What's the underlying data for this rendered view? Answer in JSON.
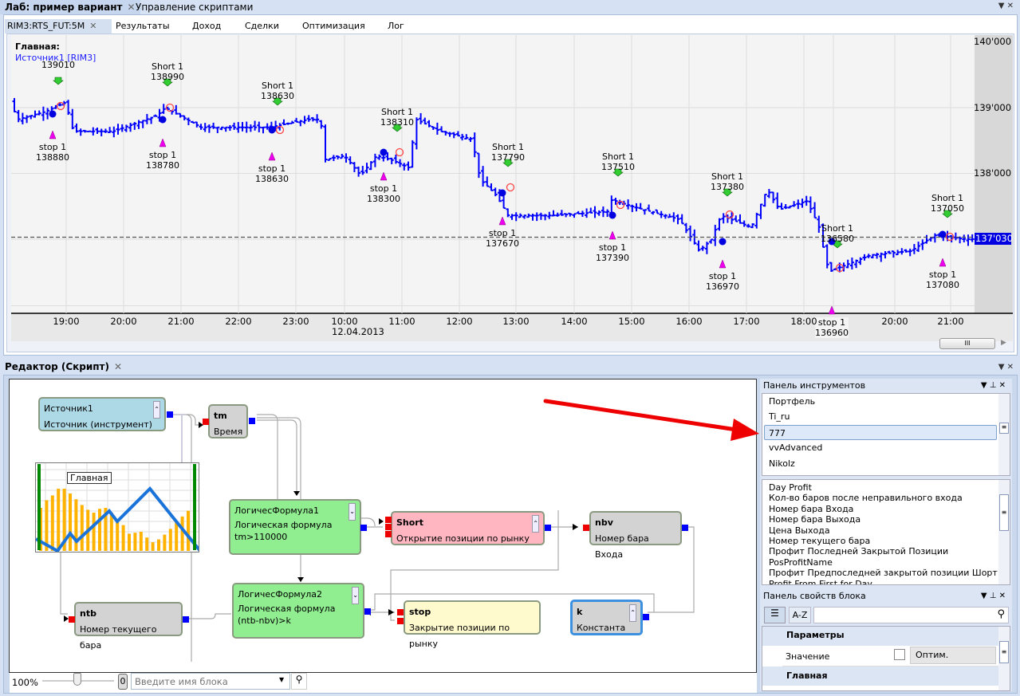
{
  "tabs": [
    {
      "label": "Лаб: пример вариант"
    },
    {
      "label": "Управление скриптами"
    }
  ],
  "subtabs": [
    "RIM3:RTS_FUT:5M",
    "Результаты",
    "Доход",
    "Сделки",
    "Оптимизация",
    "Лог"
  ],
  "chart": {
    "title": "Главная:",
    "source": "Источник1 [RIM3]",
    "price_ticks": [
      "140'000",
      "139'000",
      "138'000"
    ],
    "last_price": "137'030",
    "time_ticks": [
      "19:00",
      "20:00",
      "21:00",
      "22:00",
      "23:00",
      "10:00",
      "11:00",
      "12:00",
      "13:00",
      "14:00",
      "15:00",
      "16:00",
      "17:00",
      "18:00",
      "19:00",
      "20:00",
      "21:00"
    ],
    "date_label": "12.04.2013",
    "price_series": [
      [
        0,
        139180
      ],
      [
        12,
        138820
      ],
      [
        47,
        138940
      ],
      [
        72,
        139080
      ],
      [
        82,
        138640
      ],
      [
        132,
        138640
      ],
      [
        187,
        138880
      ],
      [
        197,
        139000
      ],
      [
        242,
        138700
      ],
      [
        282,
        138700
      ],
      [
        327,
        138700
      ],
      [
        377,
        138820
      ],
      [
        392,
        138820
      ],
      [
        397,
        138210
      ],
      [
        422,
        138270
      ],
      [
        442,
        137970
      ],
      [
        462,
        138270
      ],
      [
        482,
        138200
      ],
      [
        502,
        138090
      ],
      [
        512,
        138820
      ],
      [
        542,
        138640
      ],
      [
        582,
        138520
      ],
      [
        592,
        137910
      ],
      [
        612,
        137670
      ],
      [
        627,
        137360
      ],
      [
        682,
        137360
      ],
      [
        752,
        137420
      ],
      [
        757,
        137600
      ],
      [
        782,
        137500
      ],
      [
        842,
        137300
      ],
      [
        867,
        136820
      ],
      [
        882,
        137000
      ],
      [
        894,
        137360
      ],
      [
        932,
        137180
      ],
      [
        952,
        137760
      ],
      [
        967,
        137450
      ],
      [
        1002,
        137580
      ],
      [
        1017,
        137180
      ],
      [
        1026,
        136640
      ],
      [
        1032,
        136520
      ],
      [
        1082,
        136760
      ],
      [
        1132,
        136820
      ],
      [
        1162,
        137060
      ],
      [
        1202,
        137000
      ]
    ],
    "trades": [
      {
        "short": "",
        "entry": "139010",
        "stop": "stop 1",
        "stop_price": "138880"
      },
      {
        "short": "Short 1",
        "entry": "138990",
        "stop": "stop 1",
        "stop_price": "138780"
      },
      {
        "short": "Short 1",
        "entry": "138630",
        "stop": "stop 1",
        "stop_price": "138630"
      },
      {
        "short": "Short 1",
        "entry": "138310",
        "stop": "stop 1",
        "stop_price": "138300"
      },
      {
        "short": "Short 1",
        "entry": "137790",
        "stop": "stop 1",
        "stop_price": "137670"
      },
      {
        "short": "Short 1",
        "entry": "137510",
        "stop": "stop 1",
        "stop_price": "137390"
      },
      {
        "short": "Short 1",
        "entry": "137380",
        "stop": "stop 1",
        "stop_price": "136970"
      },
      {
        "short": "Short 1",
        "entry": "136580",
        "stop": "stop 1",
        "stop_price": "136960"
      },
      {
        "short": "Short 1",
        "entry": "137050",
        "stop": "stop 1",
        "stop_price": "137080"
      }
    ]
  },
  "editor": {
    "title": "Редактор (Скрипт)",
    "blocks": {
      "source": {
        "name": "Источник1",
        "desc": "Источник (инструмент)"
      },
      "tm": {
        "name": "tm",
        "desc": "Время"
      },
      "chart_label": "Главная",
      "lf1": {
        "name": "ЛогичесФормула1",
        "desc": "Логическая формула",
        "formula": "tm>110000"
      },
      "short": {
        "name": "Short",
        "desc": "Открытие позиции по рынку"
      },
      "nbv": {
        "name": "nbv",
        "desc": "Номер бара Входа"
      },
      "ntb": {
        "name": "ntb",
        "desc": "Номер текущего бара"
      },
      "lf2": {
        "name": "ЛогичесФормула2",
        "desc": "Логическая формула",
        "formula": "(ntb-nbv)>k"
      },
      "stop": {
        "name": "stop",
        "desc": "Закрытие позиции по рынку"
      },
      "k": {
        "name": "k",
        "desc": "Константа"
      }
    },
    "zoom": "100%",
    "zoom_value": 0.5,
    "counter": "0",
    "search_placeholder": "Введите имя блока"
  },
  "instruments": {
    "title": "Панель инструментов",
    "items": [
      "Портфель",
      "Ti_ru",
      "777",
      "vvAdvanced",
      "Nikolz"
    ],
    "selected": "777",
    "list2": [
      "Day Profit",
      "Кол-во баров после неправильного входа",
      "Номер бара Входа",
      "Номер бара Выхода",
      "Цена Выхода",
      "Номер текущего бара",
      "Профит Последней Закрытой Позиции",
      "PosProfitName",
      "Профит Предпоследней закрытой позиции Шорт",
      "Profit From First for Day"
    ]
  },
  "props": {
    "title": "Панель свойств блока",
    "az": "A-Z",
    "section1": "Параметры",
    "row_label": "Значение",
    "optim": "Оптим.",
    "section2": "Главная"
  },
  "colors": {
    "bars": "#0000ff",
    "accent": "#0000e0",
    "arrow": "#e00000"
  }
}
